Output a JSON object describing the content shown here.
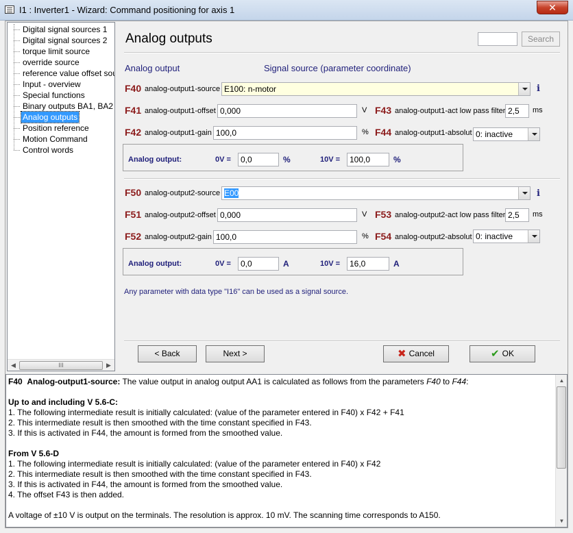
{
  "window": {
    "title": "I1 : Inverter1 - Wizard: Command positioning for axis 1",
    "close_label": "✕"
  },
  "sidebar": {
    "items": [
      {
        "label": "Digital signal sources 1"
      },
      {
        "label": "Digital signal sources 2"
      },
      {
        "label": "torque limit source"
      },
      {
        "label": "override source"
      },
      {
        "label": "reference value offset source"
      },
      {
        "label": "Input - overview"
      },
      {
        "label": "Special functions"
      },
      {
        "label": "Binary outputs BA1, BA2"
      },
      {
        "label": "Analog outputs"
      },
      {
        "label": "Position reference"
      },
      {
        "label": "Motion Command"
      },
      {
        "label": "Control words"
      }
    ],
    "selected": "Analog outputs",
    "scroll_grip": "III"
  },
  "main": {
    "title": "Analog outputs",
    "search_value": "",
    "search_button": "Search",
    "col_left": "Analog output",
    "col_right": "Signal source (parameter coordinate)",
    "f40": {
      "code": "F40",
      "label": "analog-output1-source",
      "value": "E100: n-motor"
    },
    "f41": {
      "code": "F41",
      "label": "analog-output1-offset",
      "value": "0,000",
      "unit": "V"
    },
    "f42": {
      "code": "F42",
      "label": "analog-output1-gain",
      "value": "100,0",
      "unit": "%"
    },
    "f43": {
      "code": "F43",
      "label": "analog-output1-act low pass filter",
      "value": "2,5",
      "unit": "ms"
    },
    "f44": {
      "code": "F44",
      "label": "analog-output1-absolut",
      "value": "0: inactive"
    },
    "box1": {
      "label": "Analog output:",
      "v0_label": "0V =",
      "v0_value": "0,0",
      "v0_unit": "%",
      "v10_label": "10V =",
      "v10_value": "100,0",
      "v10_unit": "%"
    },
    "f50": {
      "code": "F50",
      "label": "analog-output2-source",
      "value": "E00"
    },
    "f51": {
      "code": "F51",
      "label": "analog-output2-offset",
      "value": "0,000",
      "unit": "V"
    },
    "f52": {
      "code": "F52",
      "label": "analog-output2-gain",
      "value": "100,0",
      "unit": "%"
    },
    "f53": {
      "code": "F53",
      "label": "analog-output2-act low pass filter",
      "value": "2,5",
      "unit": "ms"
    },
    "f54": {
      "code": "F54",
      "label": "analog-output2-absolut",
      "value": "0: inactive"
    },
    "box2": {
      "label": "Analog output:",
      "v0_label": "0V =",
      "v0_value": "0,0",
      "v0_unit": "A",
      "v10_label": "10V =",
      "v10_value": "16,0",
      "v10_unit": "A"
    },
    "info_glyph": "i",
    "note": "Any parameter with data type \"I16\" can be used as a signal source."
  },
  "buttons": {
    "back": "< Back",
    "next": "Next >",
    "cancel": "Cancel",
    "ok": "OK"
  },
  "help": {
    "head_code": "F40",
    "head_title": "Analog-output1-source:",
    "head_text": " The value output in analog output AA1 is calculated as follows from the parameters ",
    "head_p1": "F40",
    "head_to": " to ",
    "head_p2": "F44",
    "head_end": ":",
    "sec1_title": "Up to and including V 5.6-C:",
    "sec1_l1": "1. The following intermediate result is initially calculated: (value of the parameter entered in F40) x F42 + F41",
    "sec1_l2": "2. This intermediate result is then smoothed with the time constant specified in F43.",
    "sec1_l3": "3. If this is activated in F44, the amount is formed from the smoothed value.",
    "sec2_title": "From V 5.6-D",
    "sec2_l1": "1. The following intermediate result is initially calculated: (value of the parameter entered in F40) x F42",
    "sec2_l2": "2. This intermediate result is then smoothed with the time constant specified in F43.",
    "sec2_l3": "3. If this is activated in F44, the amount is formed from the smoothed value.",
    "sec2_l4": "4. The offset F43 is then added.",
    "footer": "A voltage of ±10 V is output on the terminals. The resolution is approx. 10 mV. The scanning time corresponds to A150."
  }
}
